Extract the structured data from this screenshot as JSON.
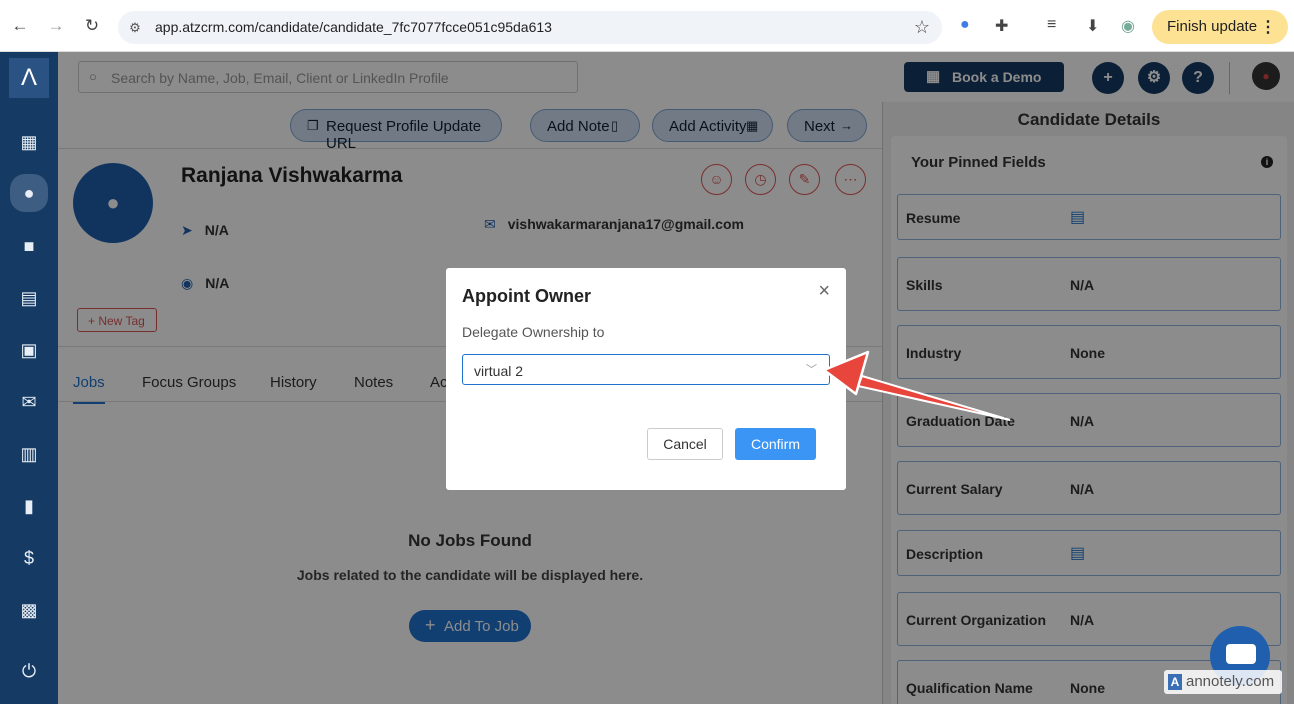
{
  "browser": {
    "url": "app.atzcrm.com/candidate/candidate_7fc7077fcce051c95da613",
    "finish_update_label": "Finish update"
  },
  "sidebar": {
    "logo": "Λ",
    "items": [
      "dashboard-icon",
      "candidates-icon",
      "jobs-icon",
      "clients-icon",
      "contacts-icon",
      "mail-icon",
      "calendar-icon",
      "reports-icon",
      "billing-icon",
      "media-icon",
      "power-icon"
    ]
  },
  "topbar": {
    "search_placeholder": "Search by Name, Job, Email, Client or LinkedIn Profile",
    "demo_label": "Book a Demo"
  },
  "actions": {
    "request_profile": "Request Profile Update URL",
    "add_note": "Add Note",
    "add_activity": "Add Activity",
    "next": "Next"
  },
  "candidate": {
    "name": "Ranjana Vishwakarma",
    "location": "N/A",
    "address": "N/A",
    "email": "vishwakarmaranjana17@gmail.com",
    "new_tag_label": "+ New Tag"
  },
  "tabs": [
    "Jobs",
    "Focus Groups",
    "History",
    "Notes",
    "Ac"
  ],
  "jobs": {
    "empty_title": "No Jobs Found",
    "empty_sub": "Jobs related to the candidate will be displayed here.",
    "add_label": "Add To Job"
  },
  "details": {
    "title": "Candidate Details",
    "pinned_title": "Your Pinned Fields",
    "fields": [
      {
        "label": "Resume",
        "value": ""
      },
      {
        "label": "Skills",
        "value": "N/A"
      },
      {
        "label": "Industry",
        "value": "None"
      },
      {
        "label": "Graduation Date",
        "value": "N/A"
      },
      {
        "label": "Current Salary",
        "value": "N/A"
      },
      {
        "label": "Description",
        "value": ""
      },
      {
        "label": "Current Organization",
        "value": "N/A"
      },
      {
        "label": "Qualification Name",
        "value": "None"
      }
    ]
  },
  "modal": {
    "title": "Appoint Owner",
    "label": "Delegate Ownership to",
    "selected": "virtual 2",
    "cancel": "Cancel",
    "confirm": "Confirm"
  },
  "watermark": "annotely.com",
  "colors": {
    "sidebar": "#153a64",
    "accent": "#1f73d0",
    "confirm": "#3a95f5",
    "arrow": "#e8453c"
  }
}
